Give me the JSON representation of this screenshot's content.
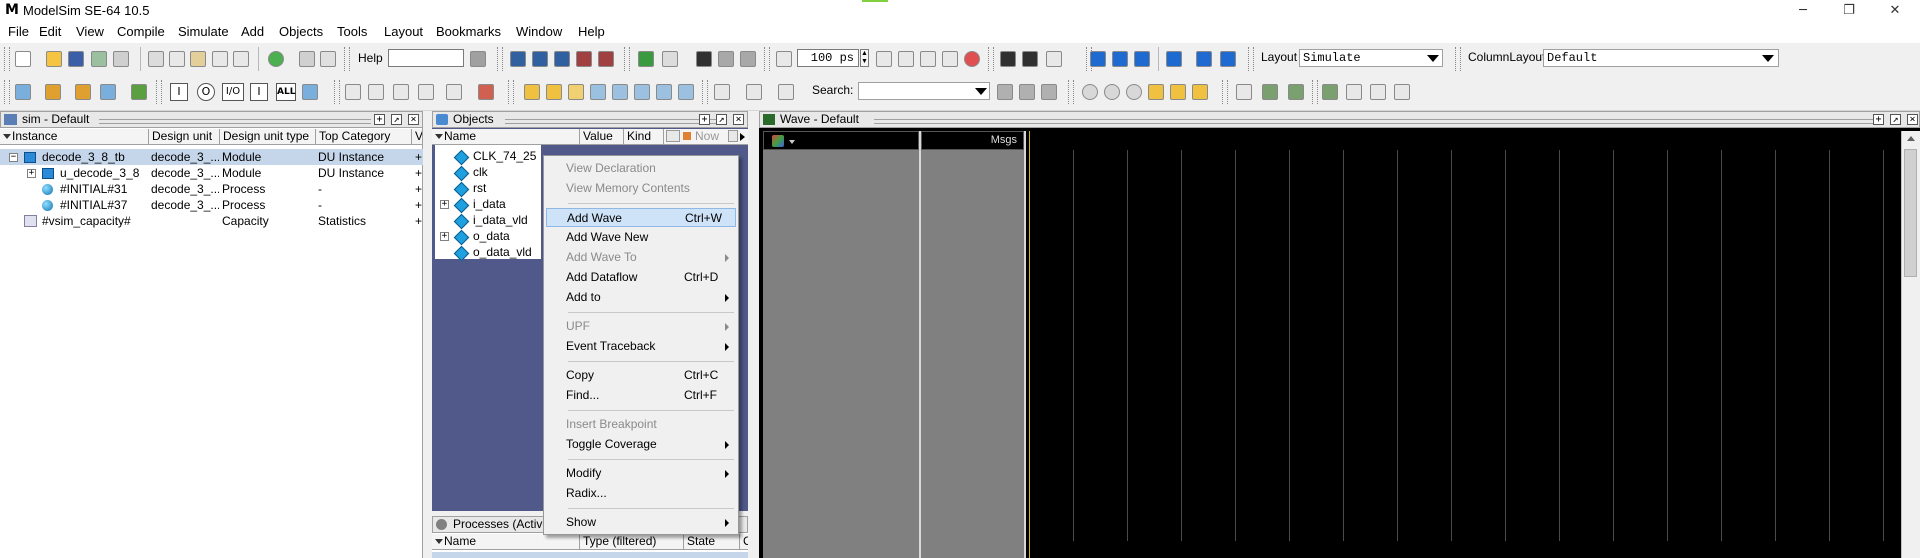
{
  "window": {
    "title": "ModelSim SE-64 10.5",
    "minimize": "─",
    "restore": "❐",
    "close": "✕"
  },
  "menu": [
    "File",
    "Edit",
    "View",
    "Compile",
    "Simulate",
    "Add",
    "Objects",
    "Tools",
    "Layout",
    "Bookmarks",
    "Window",
    "Help"
  ],
  "toolbar": {
    "help_label": "Help",
    "help_value": "",
    "run_length": "100 ps",
    "layout_label": "Layout",
    "layout_value": "Simulate",
    "column_layout_label": "ColumnLayout",
    "column_layout_value": "Default",
    "search_label": "Search:",
    "search_value": "",
    "filter_buttons": [
      "I",
      "O",
      "I/O",
      "I",
      "ALL"
    ]
  },
  "sim_pane": {
    "title": "sim - Default",
    "columns": [
      "Instance",
      "Design unit",
      "Design unit type",
      "Top Category",
      "V"
    ],
    "rows": [
      {
        "instance": "decode_3_8_tb",
        "design_unit": "decode_3_...",
        "type": "Module",
        "category": "DU Instance",
        "v": "+"
      },
      {
        "instance": "u_decode_3_8",
        "design_unit": "decode_3_...",
        "type": "Module",
        "category": "DU Instance",
        "v": "+"
      },
      {
        "instance": "#INITIAL#31",
        "design_unit": "decode_3_...",
        "type": "Process",
        "category": "-",
        "v": "+"
      },
      {
        "instance": "#INITIAL#37",
        "design_unit": "decode_3_...",
        "type": "Process",
        "category": "-",
        "v": "+"
      },
      {
        "instance": "#vsim_capacity#",
        "design_unit": "",
        "type": "Capacity",
        "category": "Statistics",
        "v": "+"
      }
    ]
  },
  "objects_pane": {
    "title": "Objects",
    "columns": [
      "Name",
      "Value",
      "Kind",
      "Now"
    ],
    "rows": [
      "CLK_74_25",
      "clk",
      "rst",
      "i_data",
      "i_data_vld",
      "o_data",
      "o_data_vld"
    ]
  },
  "processes_pane": {
    "title": "Processes (Active)",
    "columns": [
      "Name",
      "Type (filtered)",
      "State",
      "C"
    ]
  },
  "wave_pane": {
    "title": "Wave - Default",
    "msgs_label": "Msgs"
  },
  "context_menu": [
    {
      "label": "View Declaration",
      "shortcut": "",
      "submenu": false,
      "disabled": true,
      "highlight": false
    },
    {
      "label": "View Memory Contents",
      "shortcut": "",
      "submenu": false,
      "disabled": true,
      "highlight": false
    },
    {
      "sep": true
    },
    {
      "label": "Add Wave",
      "shortcut": "Ctrl+W",
      "submenu": false,
      "disabled": false,
      "highlight": true
    },
    {
      "label": "Add Wave New",
      "shortcut": "",
      "submenu": false,
      "disabled": false,
      "highlight": false
    },
    {
      "label": "Add Wave To",
      "shortcut": "",
      "submenu": true,
      "disabled": true,
      "highlight": false
    },
    {
      "label": "Add Dataflow",
      "shortcut": "Ctrl+D",
      "submenu": false,
      "disabled": false,
      "highlight": false
    },
    {
      "label": "Add to",
      "shortcut": "",
      "submenu": true,
      "disabled": false,
      "highlight": false
    },
    {
      "sep": true
    },
    {
      "label": "UPF",
      "shortcut": "",
      "submenu": true,
      "disabled": true,
      "highlight": false
    },
    {
      "label": "Event Traceback",
      "shortcut": "",
      "submenu": true,
      "disabled": false,
      "highlight": false
    },
    {
      "sep": true
    },
    {
      "label": "Copy",
      "shortcut": "Ctrl+C",
      "submenu": false,
      "disabled": false,
      "highlight": false
    },
    {
      "label": "Find...",
      "shortcut": "Ctrl+F",
      "submenu": false,
      "disabled": false,
      "highlight": false
    },
    {
      "sep": true
    },
    {
      "label": "Insert Breakpoint",
      "shortcut": "",
      "submenu": false,
      "disabled": true,
      "highlight": false
    },
    {
      "label": "Toggle Coverage",
      "shortcut": "",
      "submenu": true,
      "disabled": false,
      "highlight": false
    },
    {
      "sep": true
    },
    {
      "label": "Modify",
      "shortcut": "",
      "submenu": true,
      "disabled": false,
      "highlight": false
    },
    {
      "label": "Radix...",
      "shortcut": "",
      "submenu": false,
      "disabled": false,
      "highlight": false
    },
    {
      "sep": true
    },
    {
      "label": "Show",
      "shortcut": "",
      "submenu": true,
      "disabled": false,
      "highlight": false
    }
  ],
  "colors": {
    "objects_bg": "#50598a",
    "wave_bg": "#000000",
    "wave_side_bg": "#808080",
    "cursor": "#d4b800",
    "selection": "#c6d6ea",
    "menu_highlight": "#cfe3f8"
  }
}
